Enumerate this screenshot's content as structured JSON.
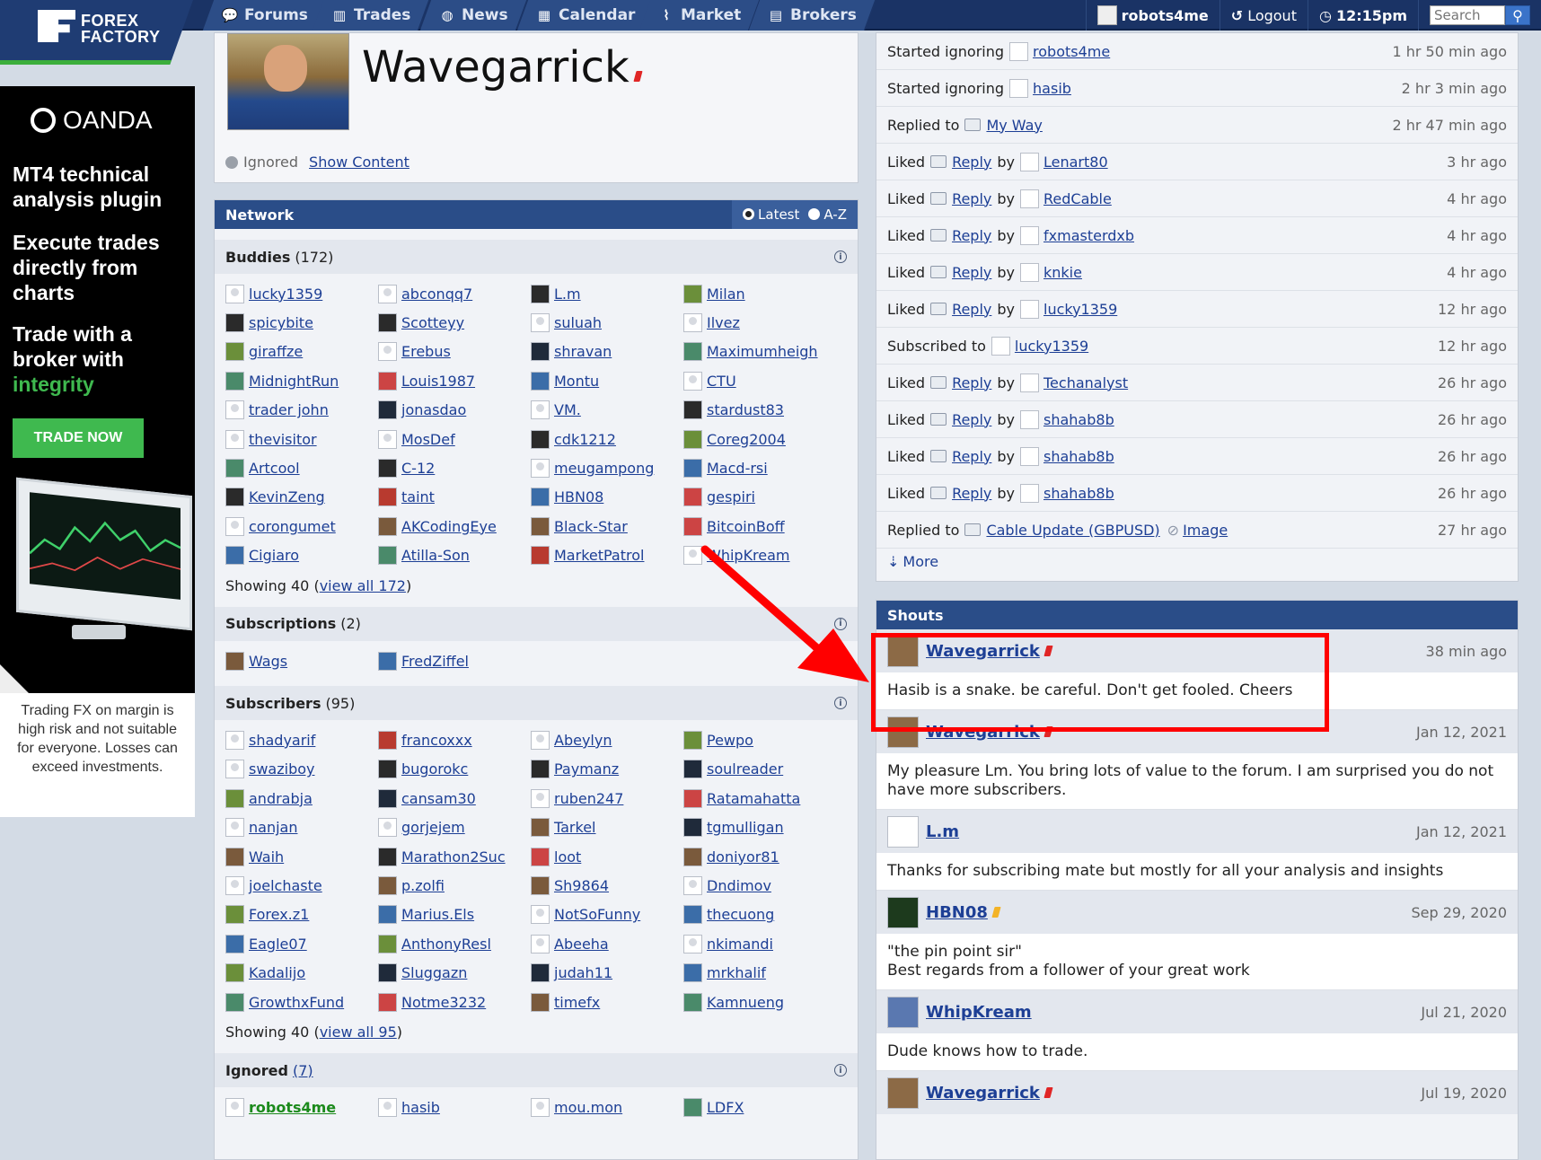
{
  "colors": {
    "nav_bg": "#1a3365",
    "accent_green": "#3cae3c",
    "panel_header": "#2a4d88",
    "link": "#1d3f95",
    "annotation_red": "#ff0000"
  },
  "logo": {
    "line1": "FOREX",
    "line2": "FACTORY"
  },
  "nav": {
    "items": [
      {
        "label": "Forums",
        "icon": "chat-bubbles-icon"
      },
      {
        "label": "Trades",
        "icon": "bar-chart-icon"
      },
      {
        "label": "News",
        "icon": "globe-icon"
      },
      {
        "label": "Calendar",
        "icon": "calendar-icon"
      },
      {
        "label": "Market",
        "icon": "line-chart-icon"
      },
      {
        "label": "Brokers",
        "icon": "brokers-icon"
      }
    ],
    "username": "robots4me",
    "logout": "Logout",
    "time": "12:15pm",
    "search_placeholder": "Search"
  },
  "ad": {
    "brand": "OANDA",
    "line1": "MT4 technical analysis plugin",
    "line2": "Execute trades directly from charts",
    "line3a": "Trade with a broker with",
    "line3b": "integrity",
    "cta": "TRADE NOW",
    "disclaimer": "Trading FX on margin is high risk and not suitable for everyone. Losses can exceed investments."
  },
  "profile": {
    "name": "Wavegarrick",
    "ignored_label": "Ignored",
    "show_content": "Show Content"
  },
  "network": {
    "title": "Network",
    "sort_latest": "Latest",
    "sort_az": "A-Z",
    "buddies": {
      "title": "Buddies",
      "count": "(172)",
      "members": [
        "lucky1359",
        "abconqq7",
        "L.m",
        "Milan",
        "spicybite",
        "Scotteyy",
        "suluah",
        "Ilvez",
        "giraffze",
        "Erebus",
        "shravan",
        "Maximumheigh",
        "MidnightRun",
        "Louis1987",
        "Montu",
        "CTU",
        "trader john",
        "jonasdao",
        "VM.",
        "stardust83",
        "thevisitor",
        "MosDef",
        "cdk1212",
        "Coreg2004",
        "Artcool",
        "C-12",
        "meugampong",
        "Macd-rsi",
        "KevinZeng",
        "taint",
        "HBN08",
        "gespiri",
        "corongumet",
        "AKCodingEye",
        "Black-Star",
        "BitcoinBoff",
        "Cigiaro",
        "Atilla-Son",
        "MarketPatrol",
        "WhipKream"
      ],
      "showing": "Showing 40 (",
      "view_all": "view all 172",
      "close": ")"
    },
    "subscriptions": {
      "title": "Subscriptions",
      "count": "(2)",
      "members": [
        "Wags",
        "FredZiffel"
      ]
    },
    "subscribers": {
      "title": "Subscribers",
      "count": "(95)",
      "members": [
        "shadyarif",
        "francoxxx",
        "Abeylyn",
        "Pewpo",
        "swaziboy",
        "bugorokc",
        "Paymanz",
        "soulreader",
        "andrabja",
        "cansam30",
        "ruben247",
        "Ratamahatta",
        "nanjan",
        "gorjejem",
        "Tarkel",
        "tgmulligan",
        "Waih",
        "Marathon2Suc",
        "loot",
        "doniyor81",
        "joelchaste",
        "p.zolfi",
        "Sh9864",
        "Dndimov",
        "Forex.z1",
        "Marius.Els",
        "NotSoFunny",
        "thecuong",
        "Eagle07",
        "AnthonyResl",
        "Abeeha",
        "nkimandi",
        "Kadalijo",
        "Sluggazn",
        "judah11",
        "mrkhalif",
        "GrowthxFund",
        "Notme3232",
        "timefx",
        "Kamnueng"
      ],
      "showing": "Showing 40 (",
      "view_all": "view all 95",
      "close": ")"
    },
    "ignored": {
      "title": "Ignored",
      "count": "(7)",
      "members": [
        "robots4me",
        "hasib",
        "mou.mon",
        "LDFX"
      ]
    }
  },
  "activity": {
    "rows": [
      {
        "verb": "Started ignoring",
        "target": "robots4me",
        "time": "1 hr 50 min ago"
      },
      {
        "verb": "Started ignoring",
        "target": "hasib",
        "time": "2 hr 3 min ago"
      },
      {
        "verb": "Replied to",
        "target": "My Way",
        "time": "2 hr 47 min ago"
      },
      {
        "verb": "Liked",
        "reply": "Reply",
        "by": "by",
        "target": "Lenart80",
        "time": "3 hr ago"
      },
      {
        "verb": "Liked",
        "reply": "Reply",
        "by": "by",
        "target": "RedCable",
        "time": "4 hr ago"
      },
      {
        "verb": "Liked",
        "reply": "Reply",
        "by": "by",
        "target": "fxmasterdxb",
        "time": "4 hr ago"
      },
      {
        "verb": "Liked",
        "reply": "Reply",
        "by": "by",
        "target": "knkie",
        "time": "4 hr ago"
      },
      {
        "verb": "Liked",
        "reply": "Reply",
        "by": "by",
        "target": "lucky1359",
        "time": "12 hr ago"
      },
      {
        "verb": "Subscribed to",
        "target": "lucky1359",
        "time": "12 hr ago"
      },
      {
        "verb": "Liked",
        "reply": "Reply",
        "by": "by",
        "target": "Techanalyst",
        "time": "26 hr ago"
      },
      {
        "verb": "Liked",
        "reply": "Reply",
        "by": "by",
        "target": "shahab8b",
        "time": "26 hr ago"
      },
      {
        "verb": "Liked",
        "reply": "Reply",
        "by": "by",
        "target": "shahab8b",
        "time": "26 hr ago"
      },
      {
        "verb": "Liked",
        "reply": "Reply",
        "by": "by",
        "target": "shahab8b",
        "time": "26 hr ago"
      },
      {
        "verb": "Replied to",
        "target": "Cable Update (GBPUSD)",
        "extra": "Image",
        "time": "27 hr ago"
      }
    ],
    "more": "More"
  },
  "shouts": {
    "title": "Shouts",
    "items": [
      {
        "name": "Wavegarrick",
        "time": "38 min ago",
        "text": "Hasib is a snake. be careful. Don't get fooled. Cheers"
      },
      {
        "name": "Wavegarrick",
        "time": "Jan 12, 2021",
        "text": "My pleasure Lm. You bring lots of value to the forum. I am surprised you do not have more subscribers."
      },
      {
        "name": "L.m",
        "time": "Jan 12, 2021",
        "text": "Thanks for subscribing mate but mostly for all your analysis and insights"
      },
      {
        "name": "HBN08",
        "time": "Sep 29, 2020",
        "text": "\"the pin point sir\"\nBest regards from a follower of your great work"
      },
      {
        "name": "WhipKream",
        "time": "Jul 21, 2020",
        "text": "Dude knows how to trade."
      },
      {
        "name": "Wavegarrick",
        "time": "Jul 19, 2020",
        "text": ""
      }
    ]
  }
}
